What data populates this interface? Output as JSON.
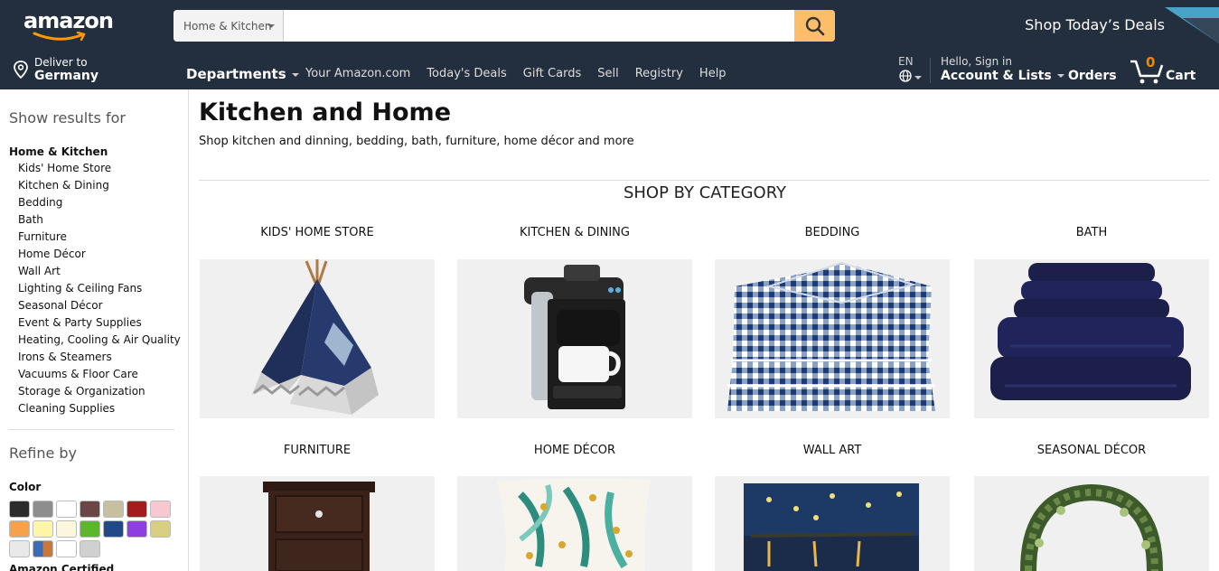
{
  "header": {
    "logo_text": "amazon",
    "search": {
      "department": "Home & Kitchen",
      "value": "",
      "placeholder": ""
    },
    "deals_banner": "Shop Today’s Deals",
    "deliver_to": {
      "line1": "Deliver to",
      "line2": "Germany"
    },
    "departments_label": "Departments",
    "nav_links": [
      "Your Amazon.com",
      "Today's Deals",
      "Gift Cards",
      "Sell",
      "Registry",
      "Help"
    ],
    "language": "EN",
    "account": {
      "line1": "Hello, Sign in",
      "line2": "Account & Lists"
    },
    "orders": "Orders",
    "cart": {
      "count": "0",
      "label": "Cart"
    },
    "colors": {
      "nav_bg": "#232f3e",
      "search_button": "#febd69",
      "cart_count": "#f08804"
    }
  },
  "sidebar": {
    "show_results_for": "Show results for",
    "root_category": "Home & Kitchen",
    "categories": [
      "Kids' Home Store",
      "Kitchen & Dining",
      "Bedding",
      "Bath",
      "Furniture",
      "Home Décor",
      "Wall Art",
      "Lighting & Ceiling Fans",
      "Seasonal Décor",
      "Event & Party Supplies",
      "Heating, Cooling & Air Quality",
      "Irons & Steamers",
      "Vacuums & Floor Care",
      "Storage & Organization",
      "Cleaning Supplies"
    ],
    "refine_by": "Refine by",
    "color_title": "Color",
    "color_swatches": [
      "#2b2b2b",
      "#8e8e8e",
      "#ffffff",
      "#6b4646",
      "#c7c0a0",
      "#a61c1c",
      "#f7c8cf",
      "#f7a14a",
      "#fdf5a7",
      "#fbf7dd",
      "#5cb82a",
      "#1f4a86",
      "#8e3fe0",
      "#d8cf82",
      "#e9e9e9",
      "multi",
      "#ffffff",
      "#d0d0d0"
    ],
    "amazon_certified": "Amazon Certified"
  },
  "main": {
    "title": "Kitchen and Home",
    "subtitle": "Shop kitchen and dinning, bedding, bath, furniture, home décor and more",
    "section_title": "SHOP BY CATEGORY",
    "tiles": [
      {
        "label": "KIDS' HOME STORE",
        "image": "teepee-tent-image"
      },
      {
        "label": "KITCHEN & DINING",
        "image": "coffee-maker-image"
      },
      {
        "label": "BEDDING",
        "image": "gingham-sheets-image"
      },
      {
        "label": "BATH",
        "image": "towel-stack-image"
      },
      {
        "label": "FURNITURE",
        "image": "nightstand-image"
      },
      {
        "label": "HOME DÉCOR",
        "image": "throw-pillow-image"
      },
      {
        "label": "WALL ART",
        "image": "starry-night-painting-image"
      },
      {
        "label": "SEASONAL DÉCOR",
        "image": "wreath-image"
      }
    ]
  }
}
